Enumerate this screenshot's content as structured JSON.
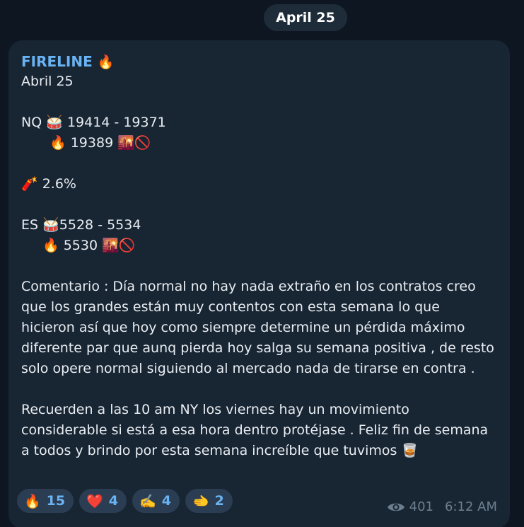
{
  "date_pill": "April 25",
  "message": {
    "sender": "FIRELINE",
    "sender_emoji": "🔥",
    "line1": "Abril 25",
    "nq_label": "NQ",
    "drum": "🥁",
    "nq_range": "19414 - 19371",
    "fire": "🔥",
    "nq_level": "19389",
    "sunrise": "🌇",
    "no_entry": "🚫",
    "dynamite": "🧨",
    "percent": "2.6%",
    "es_label": "ES",
    "es_range": "5528 - 5534",
    "es_level": "5530",
    "comment": "Comentario : Día normal no hay nada extraño en los contratos creo que los grandes están muy contentos con esta semana lo que hicieron así que hoy como siempre determine un pérdida máximo diferente par que aunq pierda hoy salga su semana positiva , de resto solo opere normal siguiendo al mercado nada de tirarse en contra .",
    "reminder": "Recuerden a las 10 am NY los viernes hay un movimiento considerable si está a esa hora dentro protéjase . Feliz fin de semana a todos y brindo por esta semana increíble que tuvimos",
    "reminder_emoji": "🥃"
  },
  "reactions": [
    {
      "emoji": "🔥",
      "count": "15"
    },
    {
      "emoji": "❤️",
      "count": "4"
    },
    {
      "emoji": "✍️",
      "count": "4"
    },
    {
      "emoji": "🫲",
      "count": "2"
    }
  ],
  "meta": {
    "views": "401",
    "time": "6:12 AM"
  }
}
